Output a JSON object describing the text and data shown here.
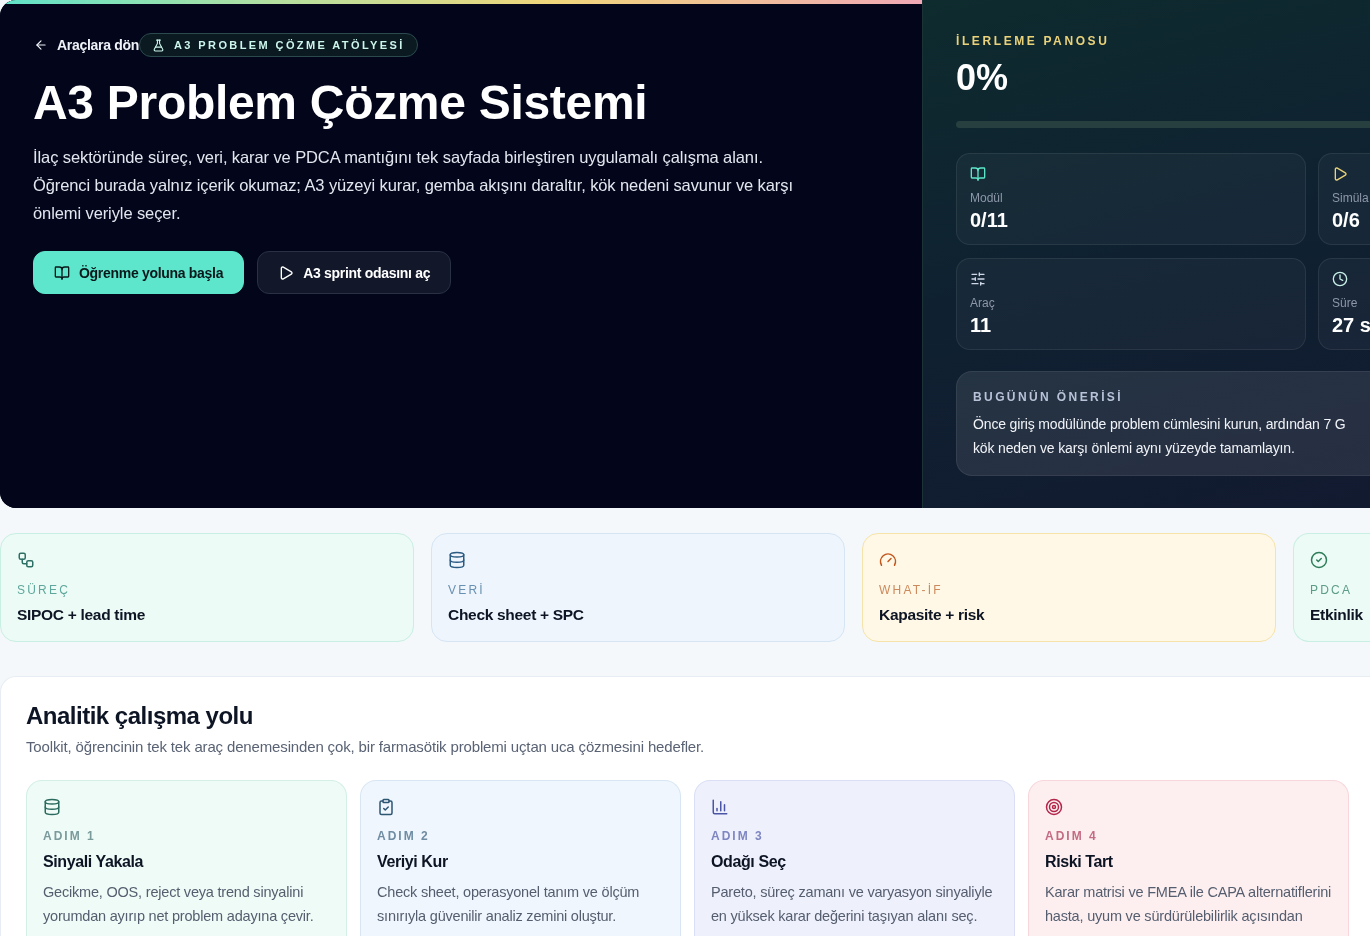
{
  "hero": {
    "back_link": "Araçlara dön",
    "badge": "A3 PROBLEM ÇÖZME ATÖLYESİ",
    "title": "A3 Problem Çözme Sistemi",
    "description": "İlaç sektöründe süreç, veri, karar ve PDCA mantığını tek sayfada birleştiren uygulamalı çalışma alanı. Öğrenci burada yalnız içerik okumaz; A3 yüzeyi kurar, gemba akışını daraltır, kök nedeni savunur ve karşı önlemi veriyle seçer.",
    "buttons": [
      {
        "label": "Öğrenme yoluna başla",
        "kind": "primary"
      },
      {
        "label": "A3 sprint odasını aç",
        "kind": "secondary"
      }
    ]
  },
  "progress_panel": {
    "title": "İLERLEME PANOSU",
    "percent": "0%",
    "level": 0,
    "stats": [
      {
        "label": "Modül",
        "value": "0/11"
      },
      {
        "label": "Simüla",
        "value": "0/6"
      },
      {
        "label": "Araç",
        "value": "11"
      },
      {
        "label": "Süre",
        "value": "27 s"
      }
    ],
    "recommendation": {
      "title": "BUGÜNÜN ÖNERİSİ",
      "lines": [
        "Önce giriş modülünde problem cümlesini kurun, ardından 7 G",
        "kök neden ve karşı önlemi aynı yüzeyde tamamlayın."
      ]
    }
  },
  "focus_cards": [
    {
      "label": "SÜREÇ",
      "value": "SIPOC + lead time",
      "color": "#ecfbf5"
    },
    {
      "label": "VERİ",
      "value": "Check sheet + SPC",
      "color": "#eef5fd"
    },
    {
      "label": "WHAT-İF",
      "value": "Kapasite + risk",
      "color": "#fff8e6"
    },
    {
      "label": "PDCA",
      "value": "Etkinlik",
      "color": "#ecfbf5"
    }
  ],
  "workflow": {
    "title": "Analitik çalışma yolu",
    "subtitle": "Toolkit, öğrencinin tek tek araç denemesinden çok, bir farmasötik problemi uçtan uca çözmesini hedefler.",
    "steps": [
      {
        "step": "ADIM 1",
        "title": "Sinyali Yakala",
        "description": "Gecikme, OOS, reject veya trend sinyalini yorumdan ayırıp net problem adayına çevir.",
        "color": "#eefbf6"
      },
      {
        "step": "ADIM 2",
        "title": "Veriyi Kur",
        "description": "Check sheet, operasyonel tanım ve ölçüm sınırıyla güvenilir analiz zemini oluştur.",
        "color": "#eff6fd"
      },
      {
        "step": "ADIM 3",
        "title": "Odağı Seç",
        "description": "Pareto, süreç zamanı ve varyasyon sinyaliyle en yüksek karar değerini taşıyan alanı seç.",
        "color": "#eef0fc"
      },
      {
        "step": "ADIM 4",
        "title": "Riski Tart",
        "description": "Karar matrisi ve FMEA ile CAPA alternatiflerini hasta, uyum ve sürdürülebilirlik açısından",
        "color": "#fdeff0"
      }
    ]
  }
}
